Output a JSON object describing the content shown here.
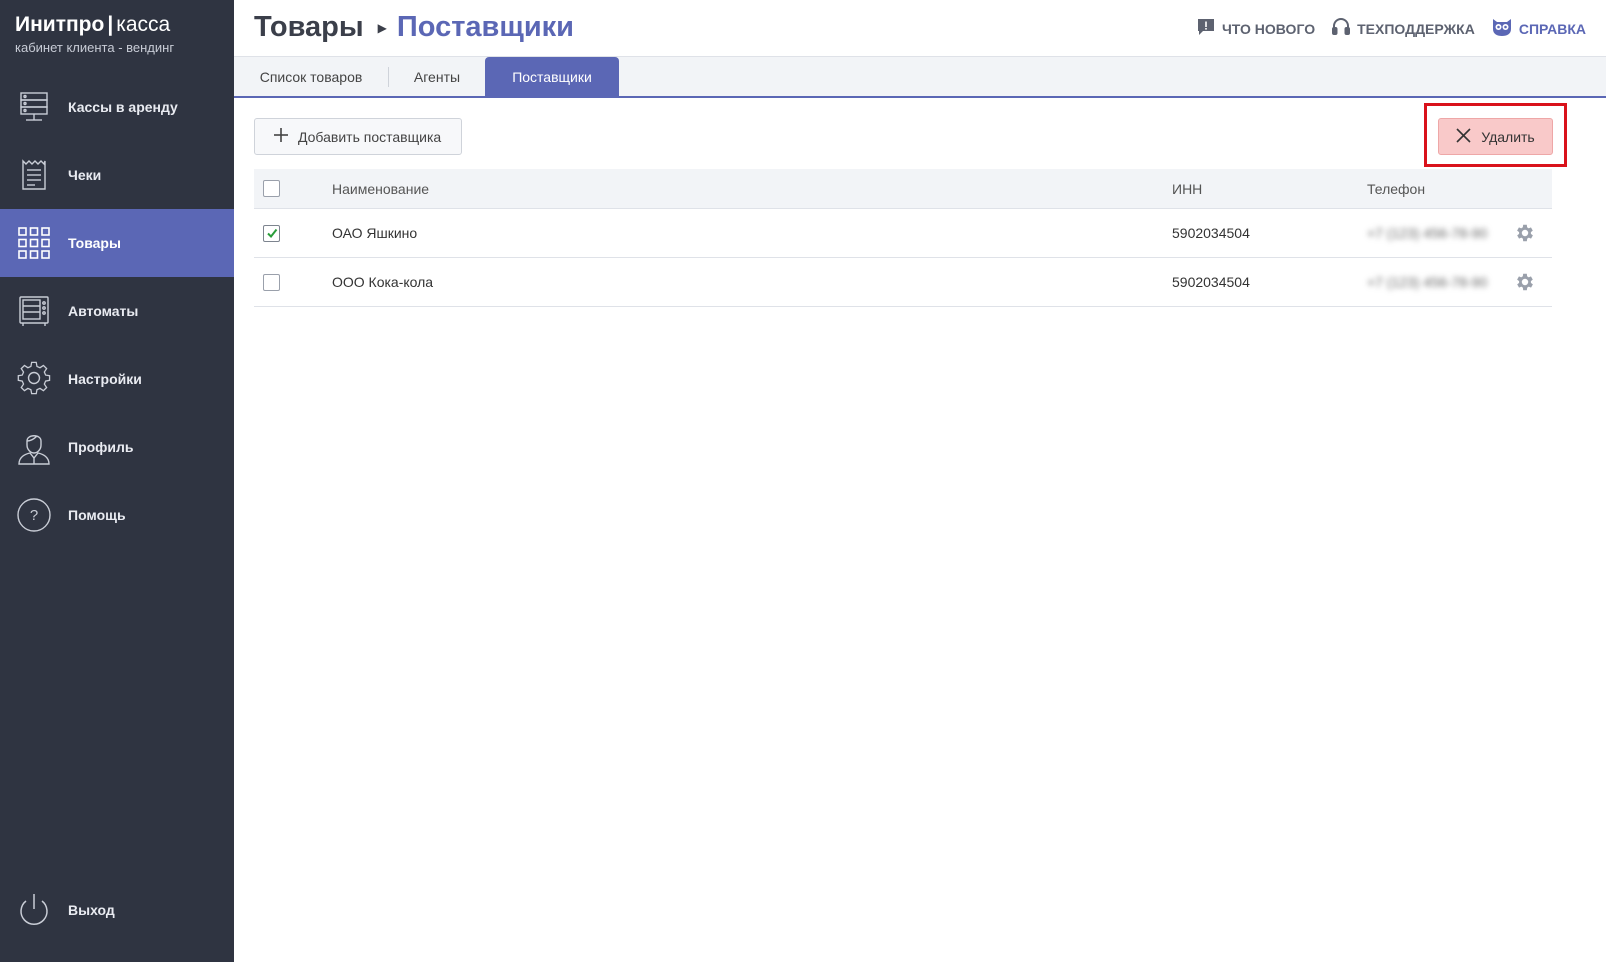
{
  "brand": {
    "name": "Инитпро",
    "separator": "|",
    "product": "касса",
    "subtitle": "кабинет клиента - вендинг"
  },
  "sidebar": {
    "items": [
      {
        "label": "Кассы в аренду",
        "icon": "server-icon",
        "active": false
      },
      {
        "label": "Чеки",
        "icon": "receipt-icon",
        "active": false
      },
      {
        "label": "Товары",
        "icon": "grid-icon",
        "active": true
      },
      {
        "label": "Автоматы",
        "icon": "vending-machine-icon",
        "active": false
      },
      {
        "label": "Настройки",
        "icon": "gear-icon",
        "active": false
      },
      {
        "label": "Профиль",
        "icon": "user-icon",
        "active": false
      },
      {
        "label": "Помощь",
        "icon": "help-icon",
        "active": false
      }
    ],
    "logout": {
      "label": "Выход",
      "icon": "power-icon"
    }
  },
  "header": {
    "breadcrumb_root": "Товары",
    "breadcrumb_current": "Поставщики",
    "links": {
      "whats_new": "ЧТО НОВОГО",
      "support": "ТЕХПОДДЕРЖКА",
      "help": "СПРАВКА"
    }
  },
  "tabs": [
    {
      "label": "Список товаров",
      "active": false
    },
    {
      "label": "Агенты",
      "active": false
    },
    {
      "label": "Поставщики",
      "active": true
    }
  ],
  "toolbar": {
    "add_label": "Добавить поставщика",
    "delete_label": "Удалить"
  },
  "table": {
    "columns": {
      "name": "Наименование",
      "inn": "ИНН",
      "phone": "Телефон"
    },
    "rows": [
      {
        "checked": true,
        "name": "ОАО Яшкино",
        "inn": "5902034504",
        "phone": "+7 (123) 456-78-90"
      },
      {
        "checked": false,
        "name": "ООО Кока-кола",
        "inn": "5902034504",
        "phone": "+7 (123) 456-78-90"
      }
    ]
  },
  "colors": {
    "sidebar_bg": "#2f3441",
    "accent": "#5b67b5",
    "delete_bg": "#f9c9c9",
    "highlight_frame": "#d9121b",
    "check": "#2a9d3a"
  }
}
